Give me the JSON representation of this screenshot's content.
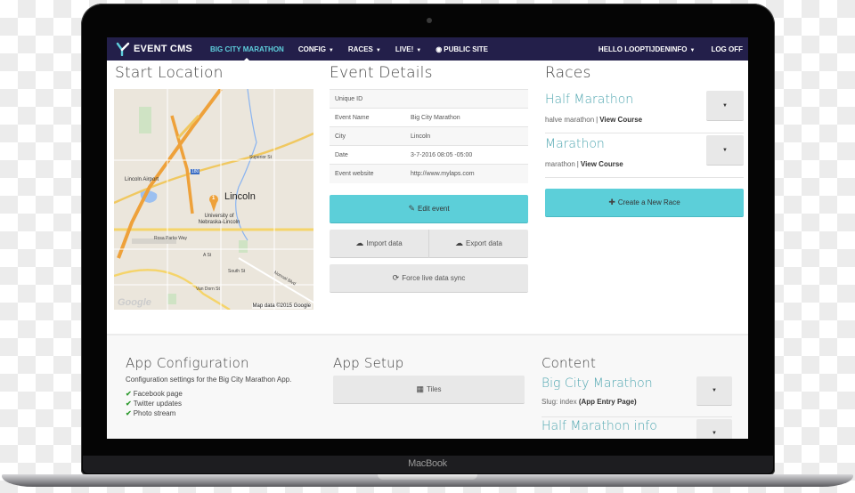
{
  "device": {
    "brand_label": "MacBook"
  },
  "navbar": {
    "app_name": "EVENT CMS",
    "items": [
      {
        "label": "BIG CITY MARATHON",
        "active": true,
        "caret": false
      },
      {
        "label": "CONFIG",
        "caret": true
      },
      {
        "label": "RACES",
        "caret": true
      },
      {
        "label": "LIVE!",
        "caret": true
      },
      {
        "label": "PUBLIC SITE",
        "icon": "eye-icon"
      }
    ],
    "user_menu": "HELLO LOOPTIJDENINFO",
    "logout": "LOG OFF",
    "caret_glyph": "▼",
    "eye_glyph": "◉"
  },
  "start_location": {
    "title": "Start Location",
    "map": {
      "labels": [
        "Lincoln",
        "Lincoln Airport",
        "University of Nebraska-Lincoln",
        "Superior St",
        "Rosa Parks Way",
        "South St",
        "Van Dorn St",
        "A St",
        "Normal Blvd",
        "180"
      ],
      "marker_label": "1",
      "attribution": "Map data ©2015 Google",
      "provider_logo": "Google"
    }
  },
  "event_details": {
    "title": "Event Details",
    "rows": [
      {
        "key": "Unique ID",
        "value": ""
      },
      {
        "key": "Event Name",
        "value": "Big City Marathon"
      },
      {
        "key": "City",
        "value": "Lincoln"
      },
      {
        "key": "Date",
        "value": "3-7-2016 08:05 -05:00"
      },
      {
        "key": "Event website",
        "value": "http://www.mylaps.com"
      }
    ],
    "edit_button": "Edit event",
    "import_button": "Import data",
    "export_button": "Export data",
    "sync_button": "Force live data sync",
    "icons": {
      "edit": "✎",
      "cloud_up": "☁",
      "cloud_down": "☁",
      "sync": "⟳"
    }
  },
  "races": {
    "title": "Races",
    "items": [
      {
        "name": "Half Marathon",
        "sub": "halve marathon",
        "link": "View Course"
      },
      {
        "name": "Marathon",
        "sub": "marathon",
        "link": "View Course"
      }
    ],
    "separator": "|",
    "dropdown_glyph": "▼",
    "create_button": "Create a New Race",
    "plus_glyph": "✚"
  },
  "app_configuration": {
    "title": "App Configuration",
    "description": "Configuration settings for the Big City Marathon App.",
    "check_glyph": "✔",
    "features": [
      "Facebook page",
      "Twitter updates",
      "Photo stream"
    ]
  },
  "app_setup": {
    "title": "App Setup",
    "tiles_button": "Tiles",
    "tiles_glyph": "▦"
  },
  "content": {
    "title": "Content",
    "items": [
      {
        "name": "Big City Marathon",
        "slug_label": "Slug: index",
        "slug_note": "(App Entry Page)"
      },
      {
        "name": "Half Marathon info"
      }
    ],
    "dropdown_glyph": "▼"
  },
  "colors": {
    "navbar_bg": "#231f4a",
    "accent": "#5ccfd9",
    "link_teal": "#4fa6b0",
    "active_nav": "#5ecfdc",
    "check_green": "#2f9a2f"
  }
}
